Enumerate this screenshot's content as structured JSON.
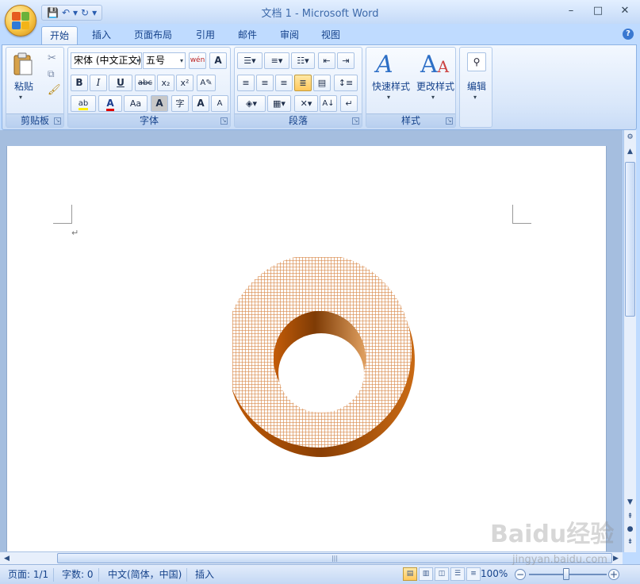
{
  "window": {
    "title": "文档 1 - Microsoft Word",
    "controls": [
      "–",
      "□",
      "✕"
    ]
  },
  "tabs": [
    {
      "label": "开始",
      "active": true
    },
    {
      "label": "插入",
      "active": false
    },
    {
      "label": "页面布局",
      "active": false
    },
    {
      "label": "引用",
      "active": false
    },
    {
      "label": "邮件",
      "active": false
    },
    {
      "label": "审阅",
      "active": false
    },
    {
      "label": "视图",
      "active": false
    }
  ],
  "ribbon": {
    "clipboard": {
      "label": "剪贴板",
      "paste_label": "粘贴"
    },
    "font": {
      "label": "字体",
      "font_name": "宋体 (中文正文)",
      "font_size": "五号",
      "bold": "B",
      "italic": "I",
      "underline": "U",
      "strike": "abc",
      "subscript": "x₂",
      "superscript": "x²",
      "highlight": "ab",
      "font_color": "A",
      "case": "Aa",
      "char_shade": "A",
      "enclose": "字",
      "grow": "A",
      "shrink": "A",
      "wen": "wén",
      "clear_format": "A"
    },
    "paragraph": {
      "label": "段落"
    },
    "styles": {
      "label": "样式",
      "quick_styles": "快速样式",
      "change_styles": "更改样式"
    },
    "editing": {
      "label": "编辑"
    }
  },
  "document": {
    "paragraph_mark": "↵"
  },
  "statusbar": {
    "page": "页面: 1/1",
    "words": "字数: 0",
    "language": "中文(简体，中国)",
    "insert_mode": "插入",
    "zoom": "100%",
    "watermark": "Baidu经验",
    "watermark_url": "jingyan.baidu.com"
  },
  "colors": {
    "ring_light": "#e9a66d",
    "ring_dark": "#b8590a",
    "ribbon_accent": "#ffc85c"
  }
}
